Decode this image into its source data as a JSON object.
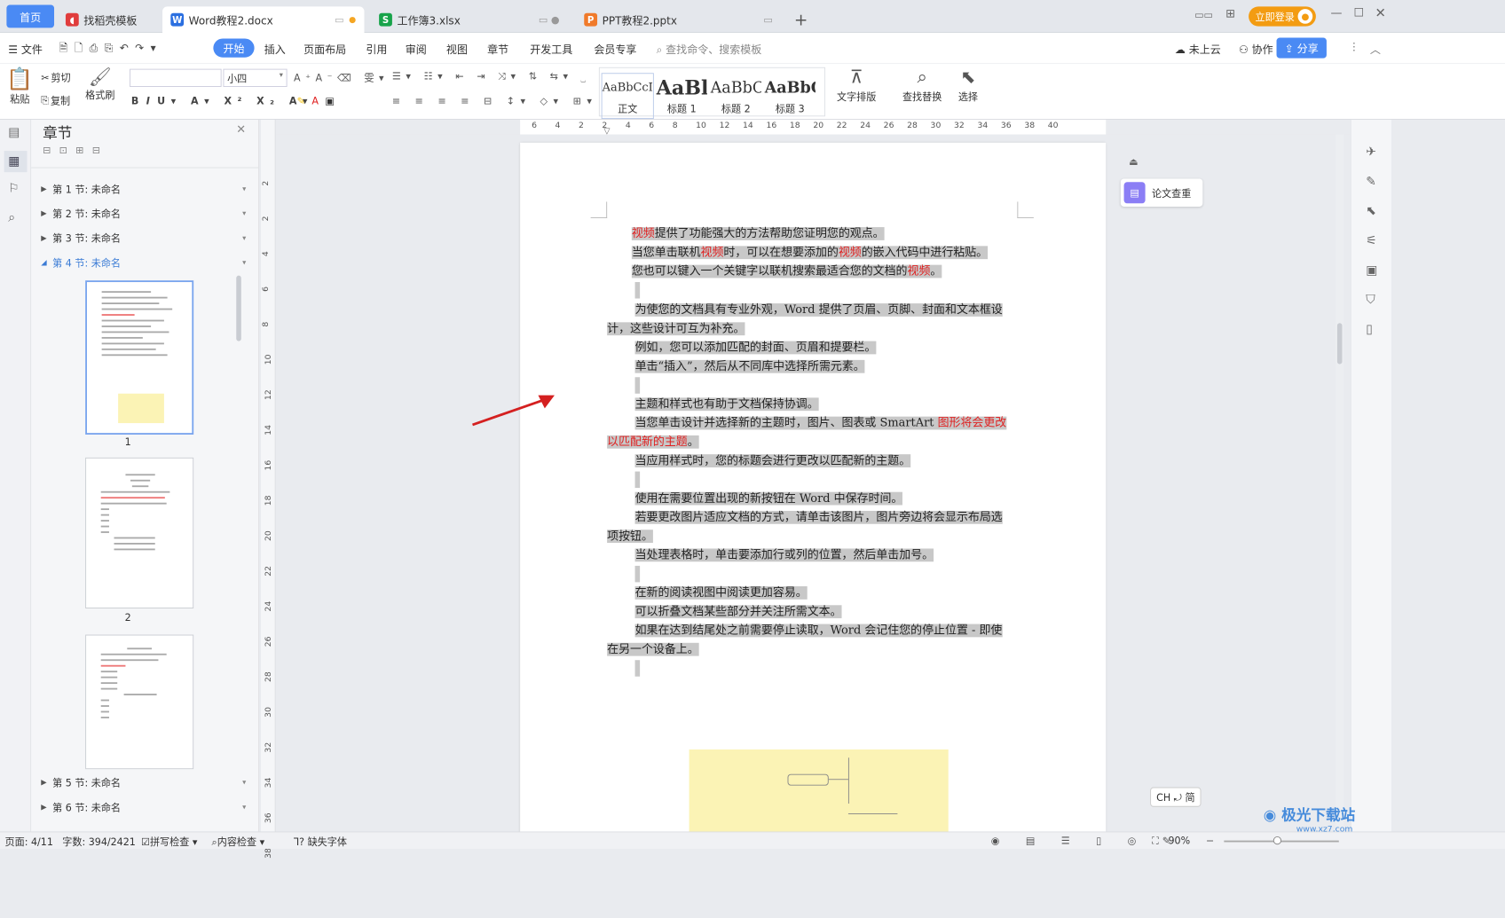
{
  "tabs": {
    "home": "首页",
    "t1": "找稻壳模板",
    "t2": "Word教程2.docx",
    "t3": "工作簿3.xlsx",
    "t4": "PPT教程2.pptx",
    "add": "+"
  },
  "title_right": {
    "login": "立即登录"
  },
  "menu": {
    "file": "文件",
    "start": "开始",
    "insert": "插入",
    "layout": "页面布局",
    "ref": "引用",
    "review": "审阅",
    "view": "视图",
    "chapter": "章节",
    "dev": "开发工具",
    "vip": "会员专享",
    "search": "查找命令、搜索模板",
    "cloud": "未上云",
    "collab": "协作",
    "share": "分享"
  },
  "ribbon": {
    "paste": "粘贴",
    "cut": "剪切",
    "copy": "复制",
    "painter": "格式刷",
    "font_size": "小四",
    "styles": [
      {
        "preview": "AaBbCcI",
        "label": "正文"
      },
      {
        "preview": "AaBl",
        "label": "标题 1"
      },
      {
        "preview": "AaBbC",
        "label": "标题 2"
      },
      {
        "preview": "AaBbC",
        "label": "标题 3"
      }
    ],
    "text_layout": "文字排版",
    "find_replace": "查找替换",
    "select": "选择"
  },
  "nav": {
    "title": "章节",
    "sections": [
      "第 1 节: 未命名",
      "第 2 节: 未命名",
      "第 3 节: 未命名",
      "第 4 节: 未命名",
      "第 5 节: 未命名",
      "第 6 节: 未命名"
    ],
    "page_labels": [
      "1",
      "2"
    ]
  },
  "ruler": {
    "h": [
      "6",
      "4",
      "2",
      "2",
      "4",
      "6",
      "8",
      "10",
      "12",
      "14",
      "16",
      "18",
      "20",
      "22",
      "24",
      "26",
      "28",
      "30",
      "32",
      "34",
      "36",
      "38",
      "40"
    ],
    "v": [
      "2",
      "2",
      "4",
      "6",
      "8",
      "10",
      "12",
      "14",
      "16",
      "18",
      "20",
      "22",
      "24",
      "26",
      "28",
      "30",
      "32",
      "34",
      "36",
      "38"
    ]
  },
  "doc": {
    "p1a": "视频",
    "p1b": "提供了功能强大的方法帮助您证明您的观点。",
    "p2a": "当您单击联机",
    "p2b": "视频",
    "p2c": "时，可以在想要添加的",
    "p2d": "视频",
    "p2e": "的嵌入代码中进行粘贴。",
    "p3a": "您也可以键入一个关键字以联机搜索最适合您的文档的",
    "p3b": "视频",
    "p3c": "。",
    "p4": "为使您的文档具有专业外观，Word 提供了页眉、页脚、封面和文本框设",
    "p4b": "计，这些设计可互为补充。",
    "p5": "例如，您可以添加匹配的封面、页眉和提要栏。",
    "p6": "单击“插入”，然后从不同库中选择所需元素。",
    "p7": "主题和样式也有助于文档保持协调。",
    "p8a": "当您单击设计并选择新的主题时，图片、图表或 SmartArt ",
    "p8b": "图形将会更改",
    "p8c": "以匹配新的主题",
    "p8d": "。",
    "p9": "当应用样式时，您的标题会进行更改以匹配新的主题。",
    "p10": "使用在需要位置出现的新按钮在 Word 中保存时间。",
    "p11": "若要更改图片适应文档的方式，请单击该图片，图片旁边将会显示布局选",
    "p11b": "项按钮。",
    "p12": "当处理表格时，单击要添加行或列的位置，然后单击加号。",
    "p13": "在新的阅读视图中阅读更加容易。",
    "p14": "可以折叠文档某些部分并关注所需文本。",
    "p15": "如果在达到结尾处之前需要停止读取，Word 会记住您的停止位置 - 即使",
    "p15b": "在另一个设备上。"
  },
  "side": {
    "paper_check": "论文查重",
    "ime": "CH ⤾ 简"
  },
  "status": {
    "page": "页面: 4/11",
    "words": "字数: 394/2421",
    "spell": "拼写检查",
    "content": "内容检查",
    "missing_font": "缺失字体",
    "zoom": "90%"
  },
  "watermark": "极光下载站",
  "watermark_url": "www.xz7.com"
}
